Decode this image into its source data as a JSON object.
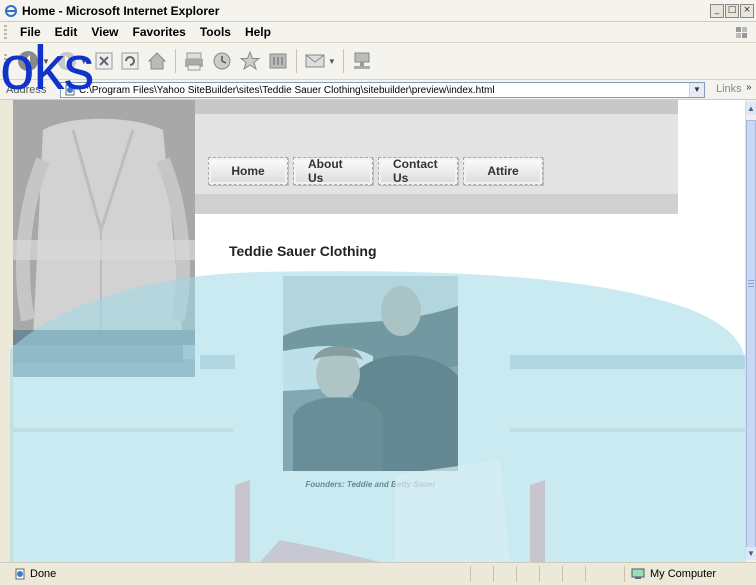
{
  "window": {
    "title": "Home - Microsoft Internet Explorer",
    "controls": [
      "_",
      "□",
      "×"
    ]
  },
  "menubar": {
    "items": [
      {
        "label": "File"
      },
      {
        "label": "Edit"
      },
      {
        "label": "View"
      },
      {
        "label": "Favorites"
      },
      {
        "label": "Tools"
      },
      {
        "label": "Help"
      }
    ]
  },
  "toolbar": {
    "icons": [
      "back-icon",
      "forward-icon",
      "stop-icon",
      "refresh-icon",
      "home-icon",
      "print-icon",
      "history-icon",
      "favorites-icon",
      "mail-icon",
      "edit-icon",
      "network-icon"
    ]
  },
  "addressbar": {
    "label": "Address",
    "url": "C:\\Program Files\\Yahoo SiteBuilder\\sites\\Teddie Sauer Clothing\\sitebuilder\\preview\\index.html",
    "links_label": "Links",
    "links_chevron": "»"
  },
  "page": {
    "nav": [
      {
        "label": "Home"
      },
      {
        "label": "About Us"
      },
      {
        "label": "Contact Us"
      },
      {
        "label": "Attire"
      }
    ],
    "heading": "Teddie Sauer Clothing",
    "caption": "Founders: Teddie and Betty Sauer"
  },
  "watermark": {
    "text": "oks"
  },
  "statusbar": {
    "status": "Done",
    "zone": "My Computer"
  },
  "colors": {
    "brand_blue": "#1133cc",
    "watermark_cyan": "#b8e6f0"
  }
}
